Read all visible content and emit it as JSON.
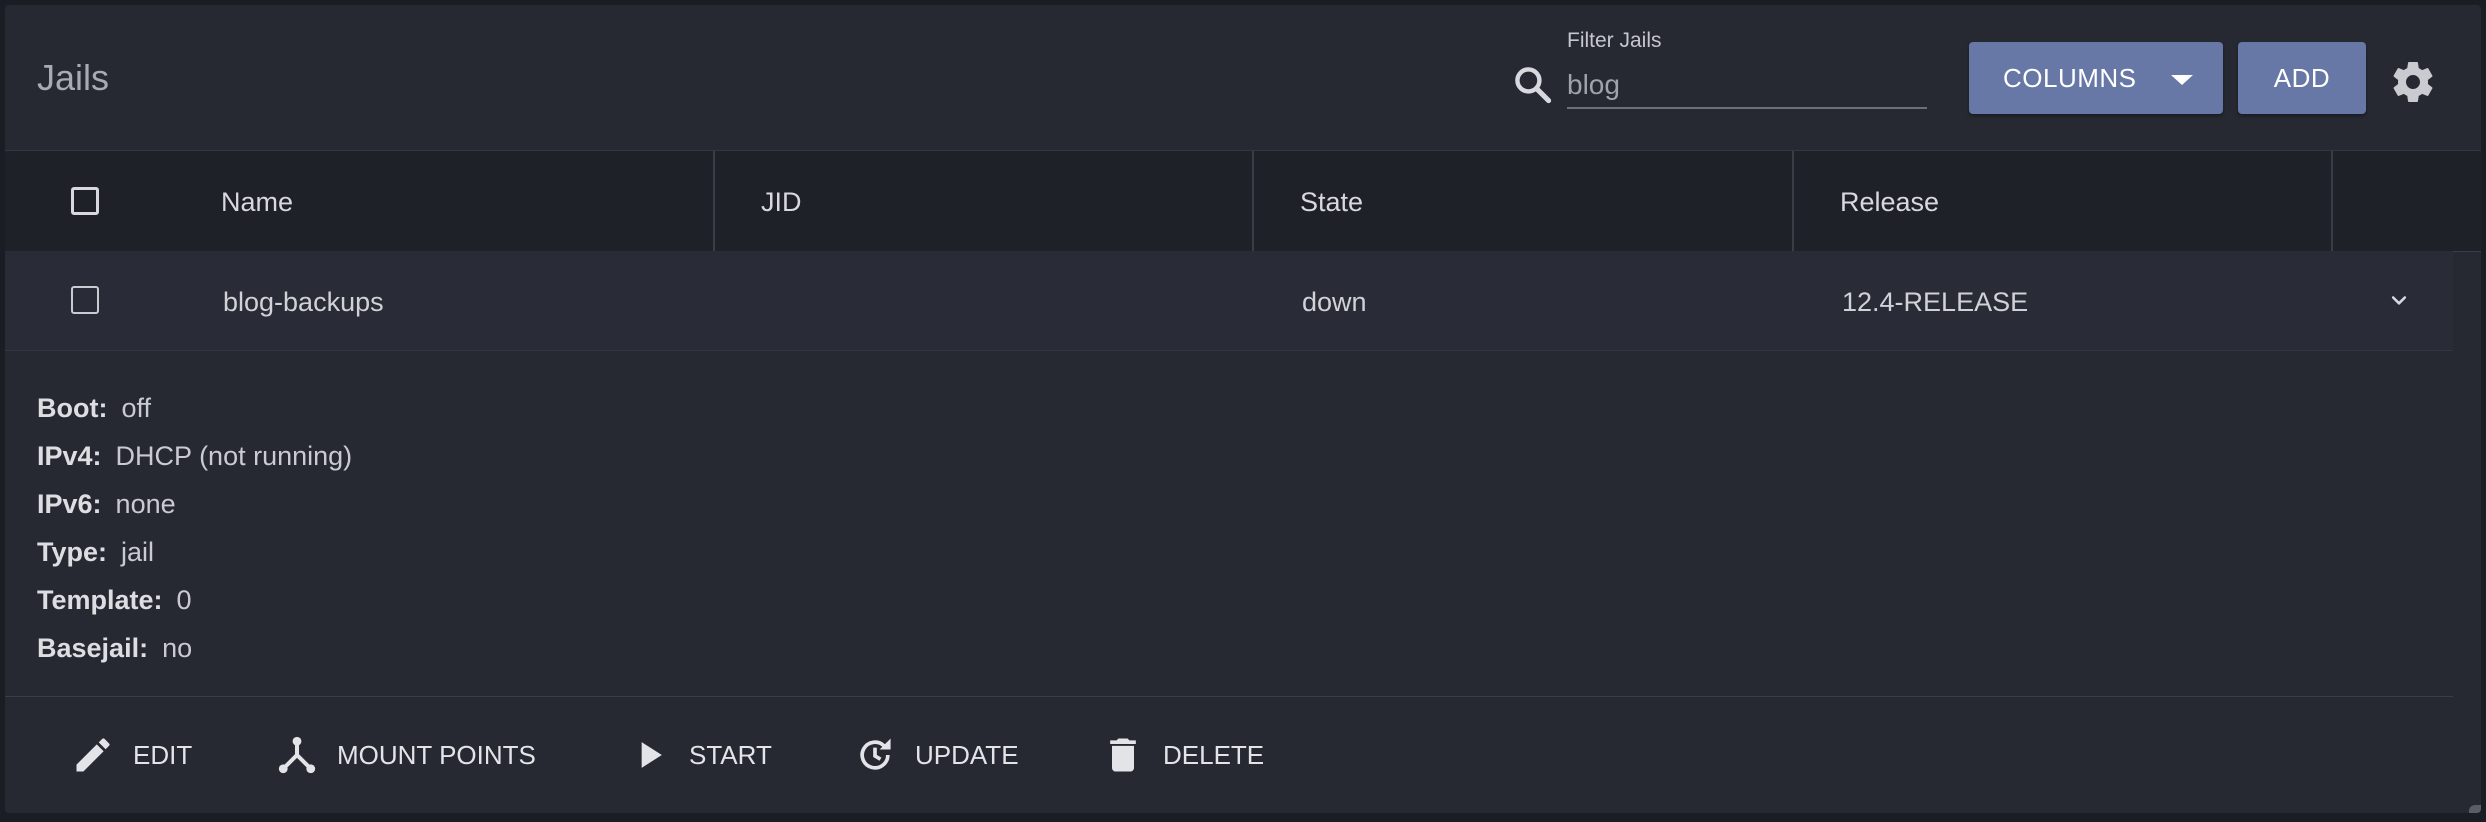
{
  "header": {
    "title": "Jails",
    "filter_label": "Filter Jails",
    "filter_value": "blog",
    "columns_button": "COLUMNS",
    "add_button": "ADD"
  },
  "table": {
    "columns": [
      "Name",
      "JID",
      "State",
      "Release"
    ],
    "rows": [
      {
        "name": "blog-backups",
        "jid": "",
        "state": "down",
        "release": "12.4-RELEASE"
      }
    ]
  },
  "details": [
    {
      "key": "Boot:",
      "value": "off"
    },
    {
      "key": "IPv4:",
      "value": "DHCP (not running)"
    },
    {
      "key": "IPv6:",
      "value": "none"
    },
    {
      "key": "Type:",
      "value": "jail"
    },
    {
      "key": "Template:",
      "value": "0"
    },
    {
      "key": "Basejail:",
      "value": "no"
    }
  ],
  "actions": [
    {
      "label": "EDIT",
      "icon": "pencil-icon"
    },
    {
      "label": "MOUNT POINTS",
      "icon": "mount-points-icon"
    },
    {
      "label": "START",
      "icon": "play-icon"
    },
    {
      "label": "UPDATE",
      "icon": "update-icon"
    },
    {
      "label": "DELETE",
      "icon": "trash-icon"
    }
  ],
  "colors": {
    "background": "#262932",
    "header_row": "#1f2128",
    "button": "#6777a6",
    "text": "#d7d9de"
  }
}
